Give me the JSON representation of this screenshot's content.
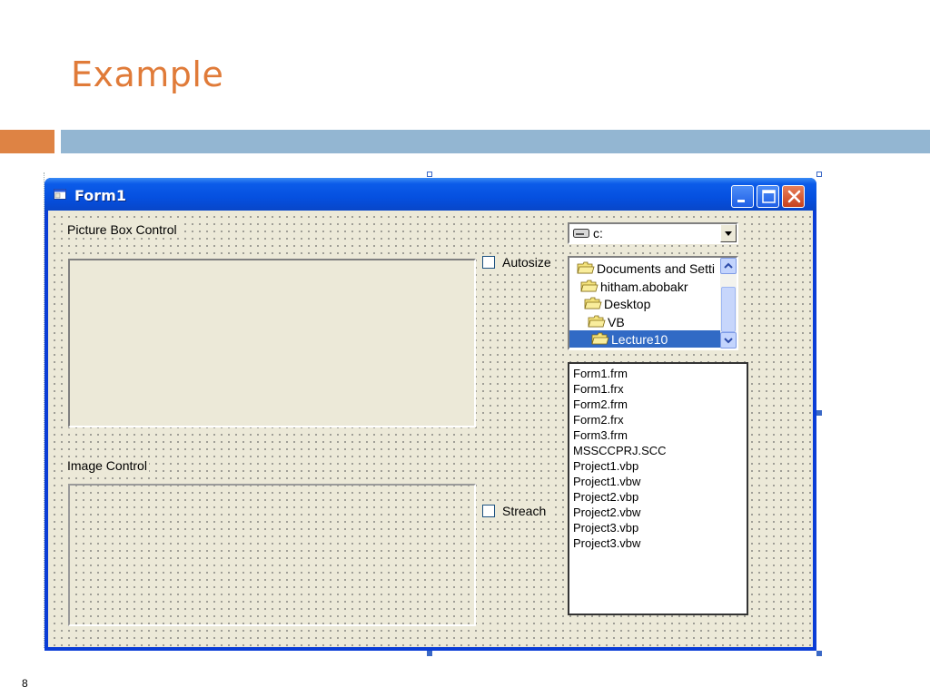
{
  "slide": {
    "title": "Example",
    "page_number": "8",
    "accent_colors": {
      "orange": "#de8344",
      "blue": "#93b6d2",
      "title": "#e07b39"
    }
  },
  "window": {
    "title": "Form1",
    "icon": "form-icon",
    "buttons": [
      "minimize-icon",
      "maximize-icon",
      "close-icon"
    ]
  },
  "form": {
    "picture_box_label": "Picture Box Control",
    "image_control_label": "Image Control",
    "autosize_checkbox": {
      "label": "Autosize",
      "checked": false
    },
    "stretch_checkbox": {
      "label": "Streach",
      "checked": false
    },
    "drive_list": {
      "value": "c:",
      "icon": "drive-icon"
    },
    "dir_list": {
      "items": [
        {
          "label": "Documents and Setti",
          "icon": "folder-open-icon",
          "selected": false
        },
        {
          "label": "hitham.abobakr",
          "icon": "folder-open-icon",
          "selected": false
        },
        {
          "label": "Desktop",
          "icon": "folder-open-icon",
          "selected": false
        },
        {
          "label": "VB",
          "icon": "folder-open-icon",
          "selected": false
        },
        {
          "label": "Lecture10",
          "icon": "folder-open-icon",
          "selected": true
        }
      ]
    },
    "file_list": {
      "items": [
        "Form1.frm",
        "Form1.frx",
        "Form2.frm",
        "Form2.frx",
        "Form3.frm",
        "MSSCCPRJ.SCC",
        "Project1.vbp",
        "Project1.vbw",
        "Project2.vbp",
        "Project2.vbw",
        "Project3.vbp",
        "Project3.vbw"
      ]
    }
  }
}
